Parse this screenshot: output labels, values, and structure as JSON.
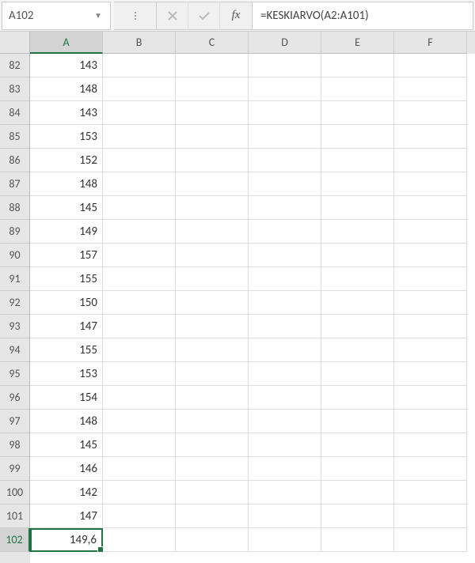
{
  "nameBox": "A102",
  "formula": "=KESKIARVO(A2:A101)",
  "fxLabel": "fx",
  "columns": [
    "A",
    "B",
    "C",
    "D",
    "E",
    "F"
  ],
  "activeColumn": "A",
  "activeRow": 102,
  "rows": [
    {
      "num": 82,
      "A": "143"
    },
    {
      "num": 83,
      "A": "148"
    },
    {
      "num": 84,
      "A": "143"
    },
    {
      "num": 85,
      "A": "153"
    },
    {
      "num": 86,
      "A": "152"
    },
    {
      "num": 87,
      "A": "148"
    },
    {
      "num": 88,
      "A": "145"
    },
    {
      "num": 89,
      "A": "149"
    },
    {
      "num": 90,
      "A": "157"
    },
    {
      "num": 91,
      "A": "155"
    },
    {
      "num": 92,
      "A": "150"
    },
    {
      "num": 93,
      "A": "147"
    },
    {
      "num": 94,
      "A": "155"
    },
    {
      "num": 95,
      "A": "153"
    },
    {
      "num": 96,
      "A": "154"
    },
    {
      "num": 97,
      "A": "148"
    },
    {
      "num": 98,
      "A": "145"
    },
    {
      "num": 99,
      "A": "146"
    },
    {
      "num": 100,
      "A": "142"
    },
    {
      "num": 101,
      "A": "147"
    },
    {
      "num": 102,
      "A": "149,6"
    }
  ],
  "selectedCell": {
    "row": 102,
    "col": "A"
  }
}
